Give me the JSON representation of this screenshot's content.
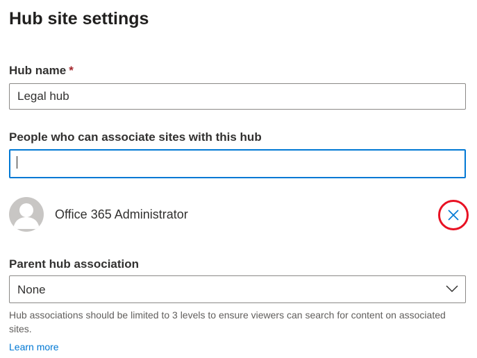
{
  "page": {
    "title": "Hub site settings"
  },
  "hub_name": {
    "label": "Hub name",
    "required_marker": "*",
    "value": "Legal hub"
  },
  "people": {
    "label": "People who can associate sites with this hub",
    "input_value": "",
    "members": [
      {
        "name": "Office 365 Administrator"
      }
    ]
  },
  "parent_hub": {
    "label": "Parent hub association",
    "selected": "None",
    "help_text": "Hub associations should be limited to 3 levels to ensure viewers can search for content on associated sites.",
    "learn_more": "Learn more"
  },
  "colors": {
    "accent": "#0078d4",
    "highlight_ring": "#e81123",
    "required": "#a4262c"
  },
  "icons": {
    "avatar": "person-silhouette-icon",
    "remove": "close-icon",
    "dropdown": "chevron-down-icon"
  }
}
